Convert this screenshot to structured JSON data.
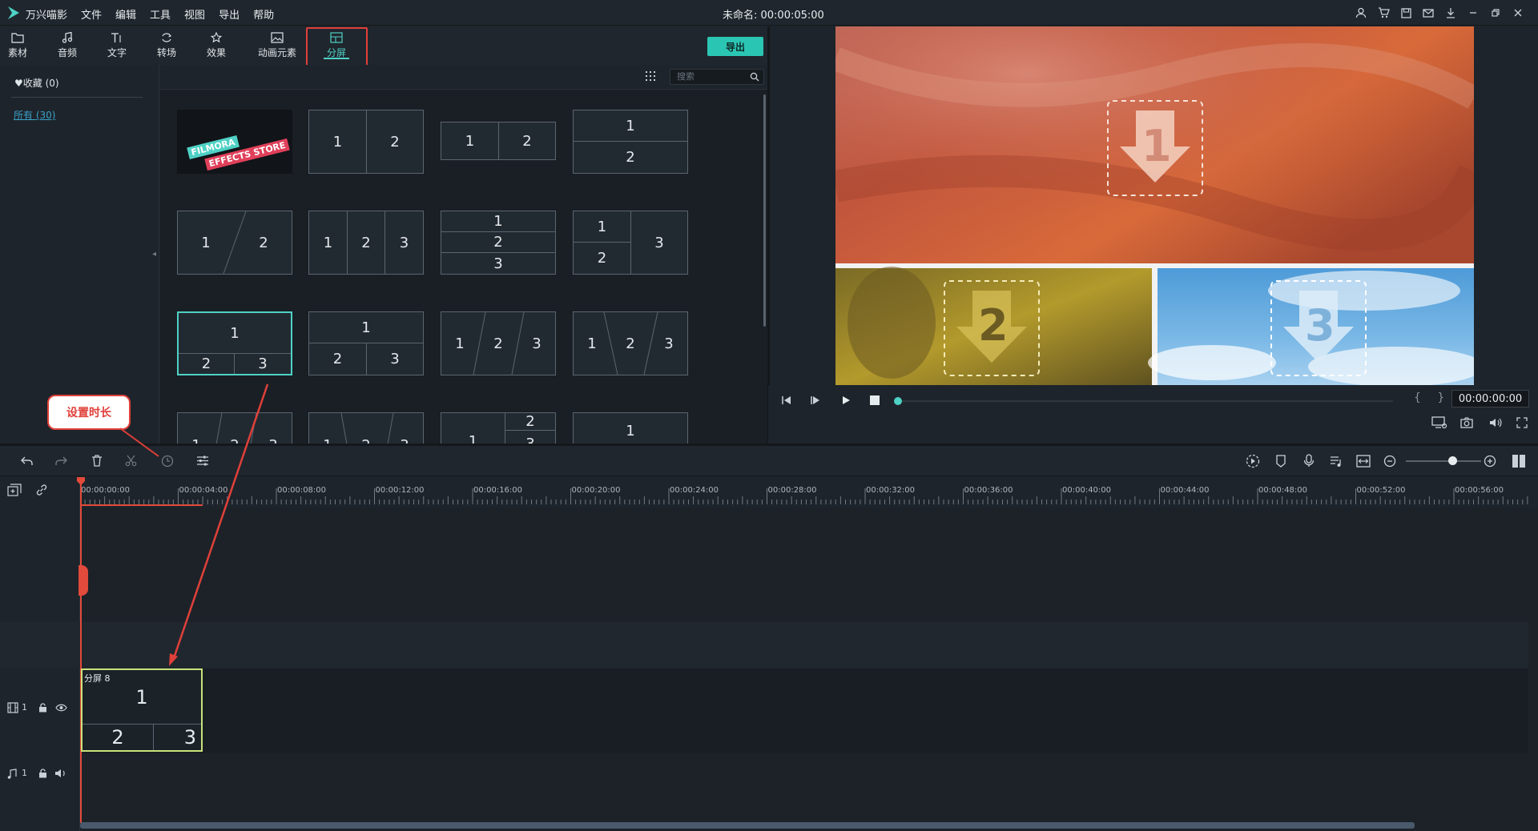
{
  "app": {
    "name": "万兴喵影",
    "project_title": "未命名: 00:00:05:00",
    "menu": [
      "文件",
      "编辑",
      "工具",
      "视图",
      "导出",
      "帮助"
    ]
  },
  "toolbar": {
    "tabs": [
      {
        "label": "素材",
        "icon": "folder-icon"
      },
      {
        "label": "音频",
        "icon": "music-note-icon"
      },
      {
        "label": "文字",
        "icon": "text-icon"
      },
      {
        "label": "转场",
        "icon": "transition-icon"
      },
      {
        "label": "效果",
        "icon": "effects-icon"
      },
      {
        "label": "动画元素",
        "icon": "image-icon"
      },
      {
        "label": "分屏",
        "icon": "split-screen-icon",
        "active": true
      }
    ],
    "export_label": "导出"
  },
  "sidebar": {
    "favorites": "收藏 (0)",
    "all": "所有 (30)"
  },
  "search": {
    "placeholder": "搜索"
  },
  "store_tile": {
    "line1": "FILMORA",
    "line2": "EFFECTS STORE"
  },
  "preview": {
    "labels": [
      "1",
      "2",
      "3"
    ],
    "timecode": "00:00:00:00",
    "brackets": "{ }"
  },
  "callout": {
    "text": "设置时长"
  },
  "ruler": {
    "ticks": [
      "00:00:00:00",
      "00:00:04:00",
      "00:00:08:00",
      "00:00:12:00",
      "00:00:16:00",
      "00:00:20:00",
      "00:00:24:00",
      "00:00:28:00",
      "00:00:32:00",
      "00:00:36:00",
      "00:00:40:00",
      "00:00:44:00",
      "00:00:48:00",
      "00:00:52:00",
      "00:00:56:00"
    ]
  },
  "tracks": {
    "video_label": "1",
    "audio_label": "1"
  },
  "clip": {
    "name": "分屏 8",
    "cells": [
      "1",
      "2",
      "3"
    ]
  },
  "colors": {
    "accent": "#4fd1c5",
    "highlight": "#e0403a",
    "clip_border": "#c9e27a"
  }
}
